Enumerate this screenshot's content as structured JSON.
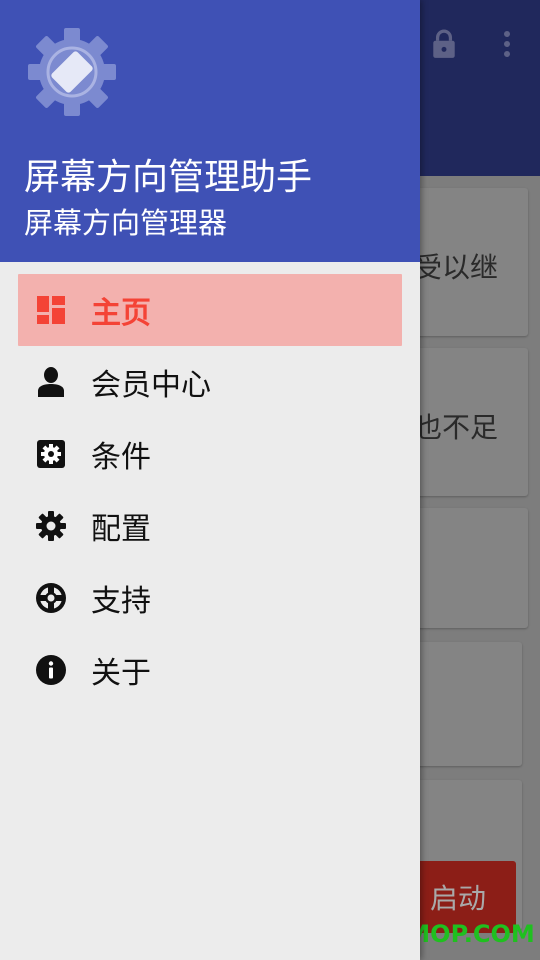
{
  "background": {
    "card_texts": [
      "受以继",
      "也不足"
    ],
    "start_button_label": "启动",
    "watermark": "ITMOP.COM"
  },
  "drawer": {
    "header": {
      "title": "屏幕方向管理助手",
      "subtitle": "屏幕方向管理器",
      "logo_icon": "screen-rotation-gear-icon"
    },
    "menu": [
      {
        "label": "主页",
        "icon": "dashboard-icon",
        "active": true
      },
      {
        "label": "会员中心",
        "icon": "person-icon",
        "active": false
      },
      {
        "label": "条件",
        "icon": "settings-box-icon",
        "active": false
      },
      {
        "label": "配置",
        "icon": "gear-icon",
        "active": false
      },
      {
        "label": "支持",
        "icon": "lifebuoy-icon",
        "active": false
      },
      {
        "label": "关于",
        "icon": "info-icon",
        "active": false
      }
    ]
  },
  "colors": {
    "header": "#3f51b5",
    "active_item_bg": "#f3b1ae",
    "active_item_text": "#f44336",
    "drawer_bg": "#ececec",
    "watermark": "#1fc01f"
  }
}
